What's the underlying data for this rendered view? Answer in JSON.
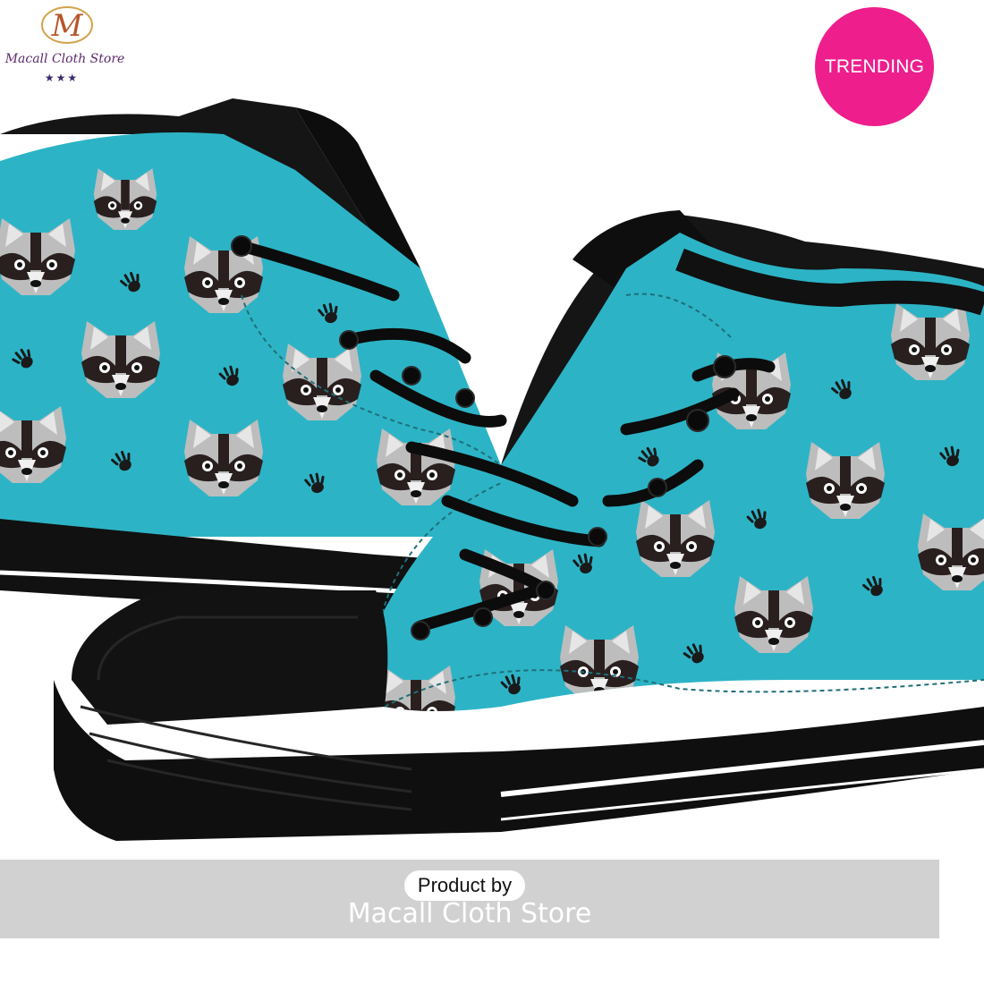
{
  "logo": {
    "store_name": "Macall Cloth Store",
    "monogram": "M",
    "stars": "★★★"
  },
  "badge": {
    "label": "TRENDING"
  },
  "caption": {
    "product_by": "Product by",
    "store_name": "Macall Cloth Store"
  },
  "colors": {
    "canvas": "#2cb4c6",
    "shoe_black": "#111111",
    "badge": "#ee1e8c",
    "raccoon_gray": "#bfbfbf",
    "raccoon_dark": "#2a1f1f"
  }
}
